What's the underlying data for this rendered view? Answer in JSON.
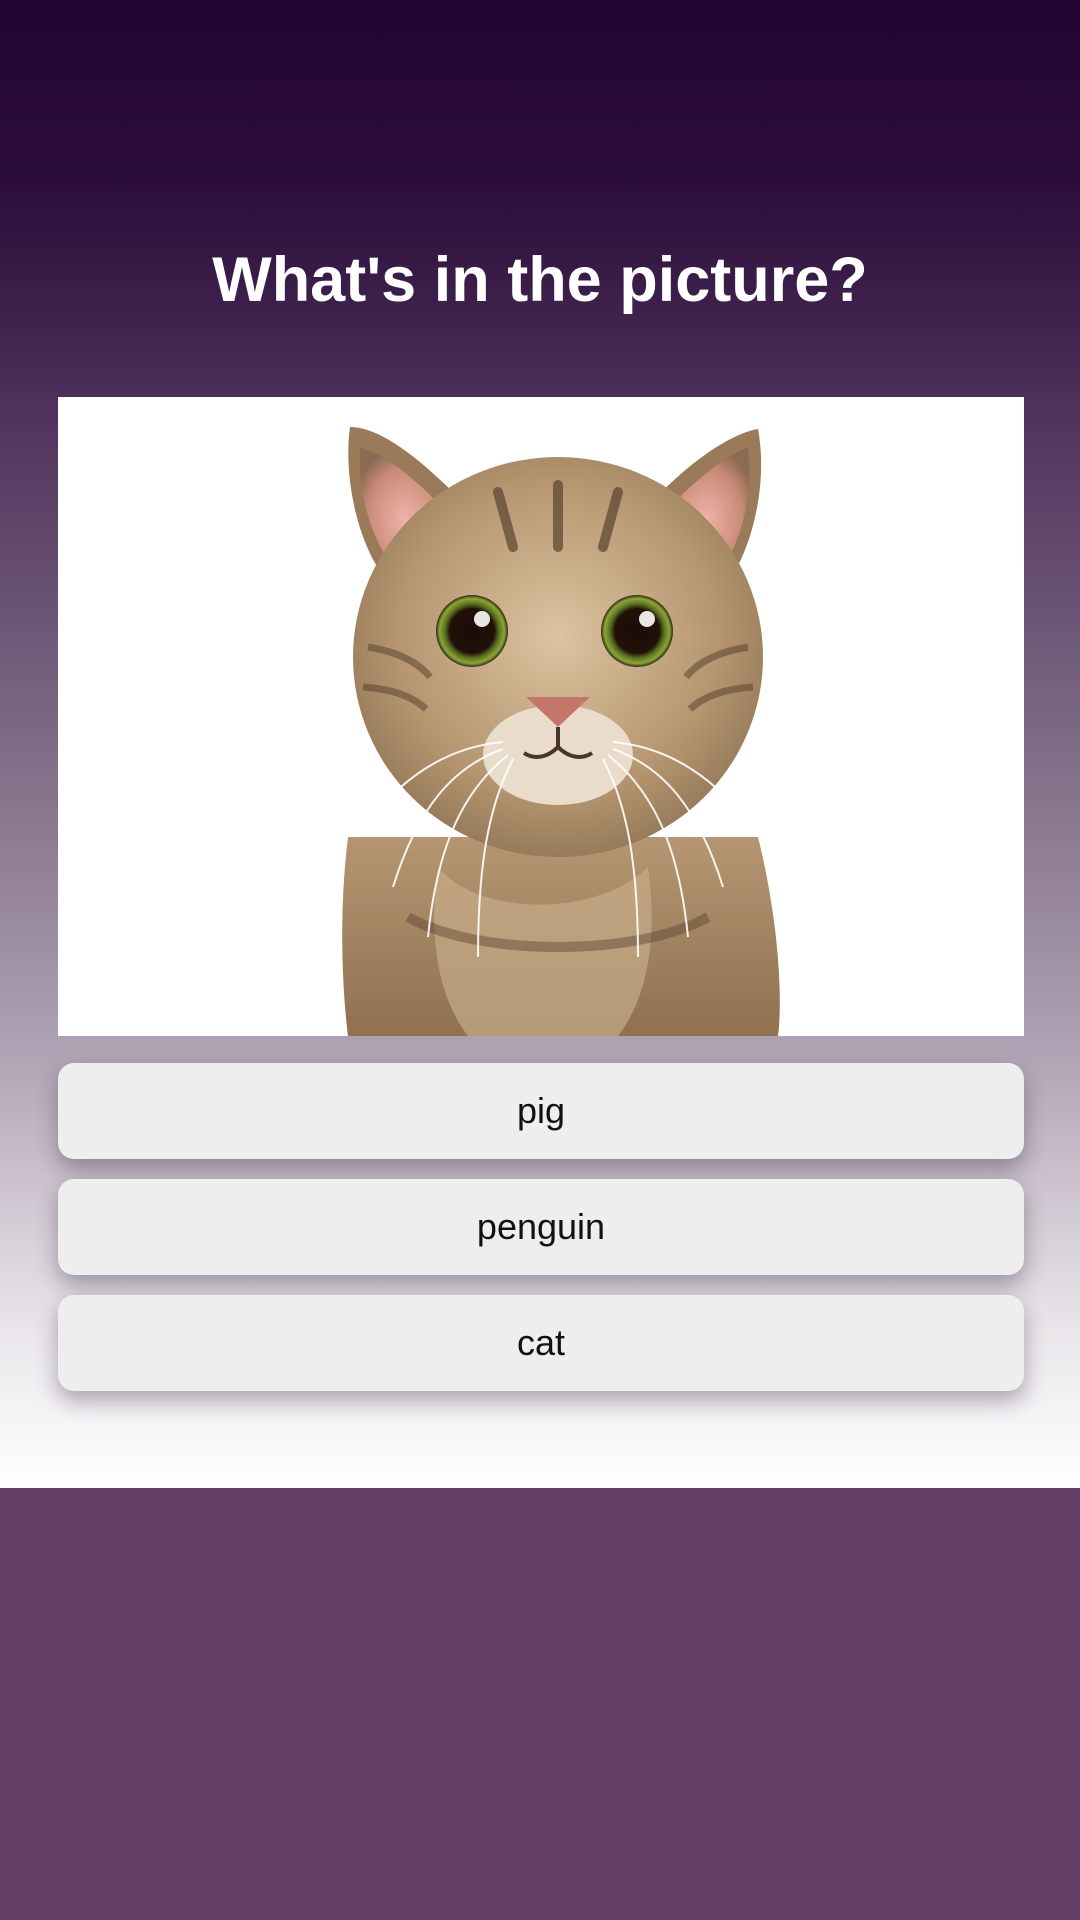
{
  "quiz": {
    "question": "What's in the picture?",
    "answers": [
      "pig",
      "penguin",
      "cat"
    ]
  },
  "colors": {
    "title_text": "#ffffff",
    "button_background": "#eeeeef",
    "button_text": "#111111",
    "background_top": "#230533",
    "background_bottom": "#633f67"
  },
  "icons": {
    "picture_subject": "cat-photo"
  }
}
